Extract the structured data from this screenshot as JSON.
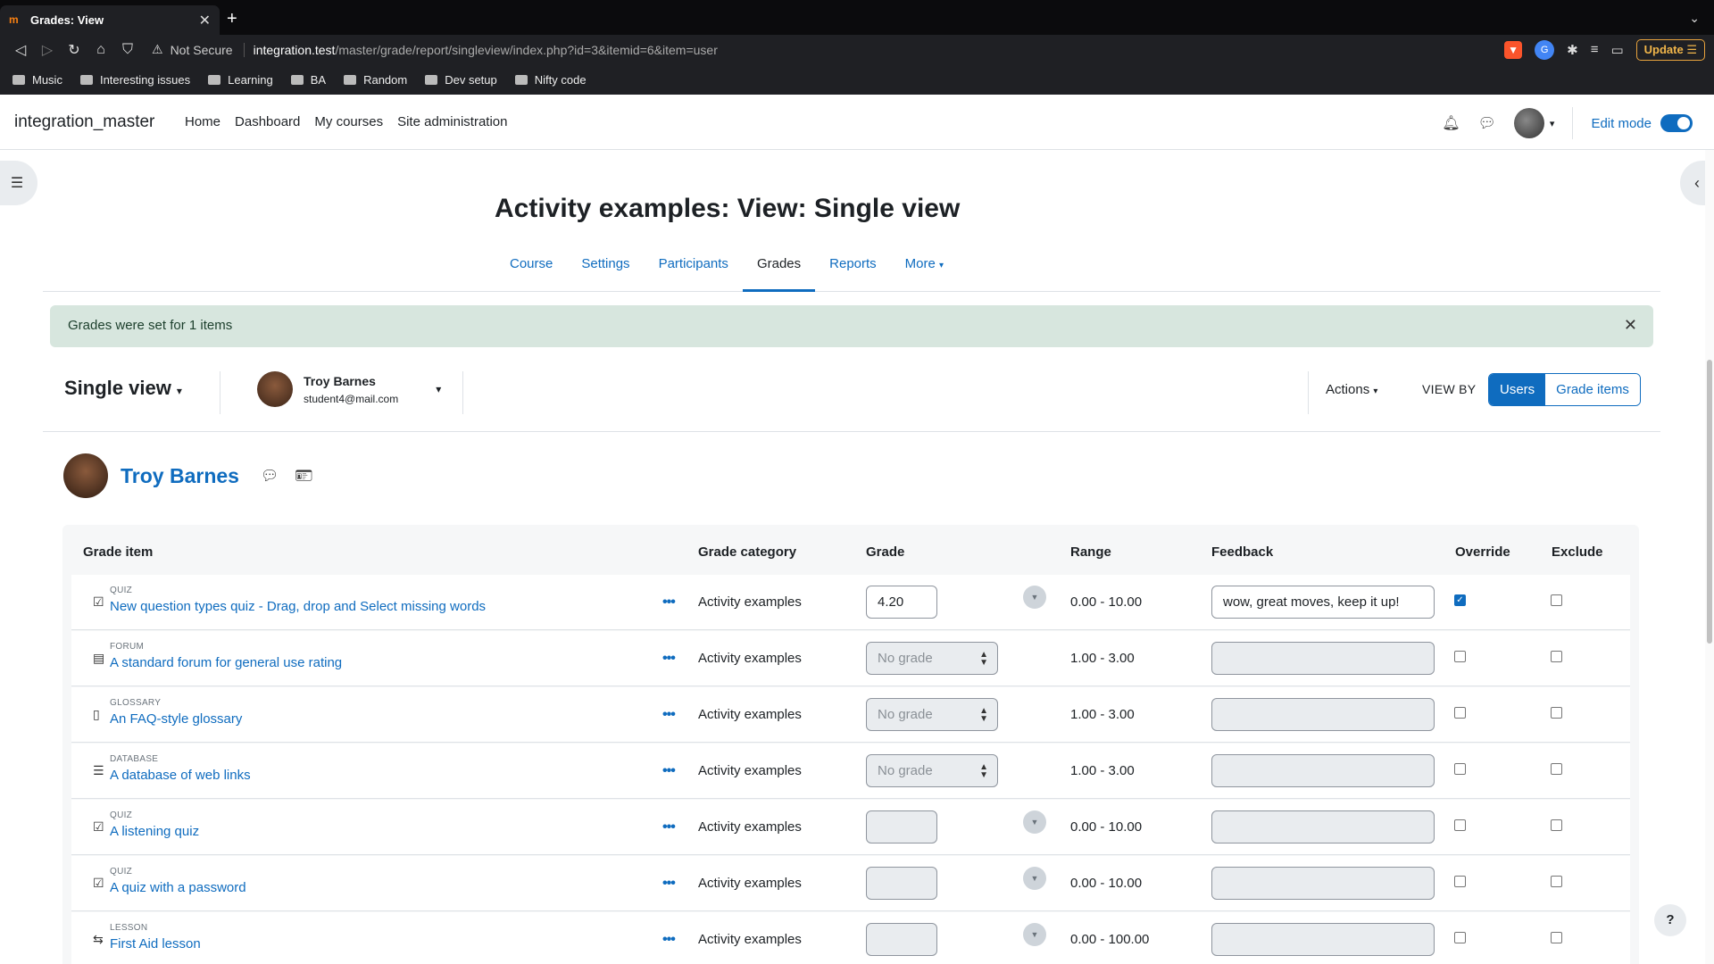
{
  "browser": {
    "tab_title": "Grades: View",
    "favicon": "m",
    "omnibox_warning": "Not Secure",
    "url_host": "integration.test",
    "url_path": "/master/grade/report/singleview/index.php?id=3&itemid=6&item=user",
    "update_label": "Update",
    "bookmarks": [
      "Music",
      "Interesting issues",
      "Learning",
      "BA",
      "Random",
      "Dev setup",
      "Nifty code"
    ]
  },
  "header": {
    "brand": "integration_master",
    "nav": [
      "Home",
      "Dashboard",
      "My courses",
      "Site administration"
    ],
    "edit_mode_label": "Edit mode"
  },
  "page": {
    "title": "Activity examples: View: Single view",
    "secondary_nav": [
      "Course",
      "Settings",
      "Participants",
      "Grades",
      "Reports",
      "More"
    ],
    "active_tab": "Grades",
    "alert": "Grades were set for 1 items"
  },
  "tertiary": {
    "view_title": "Single view",
    "user_name": "Troy Barnes",
    "user_email": "student4@mail.com",
    "actions_label": "Actions",
    "view_by_label": "VIEW BY",
    "view_users": "Users",
    "view_grade_items": "Grade items"
  },
  "user_heading": {
    "name": "Troy Barnes"
  },
  "table": {
    "headers": {
      "grade_item": "Grade item",
      "grade_category": "Grade category",
      "grade": "Grade",
      "range": "Range",
      "feedback": "Feedback",
      "override": "Override",
      "exclude": "Exclude"
    },
    "rows": [
      {
        "module": "QUIZ",
        "name": "New question types quiz - Drag, drop and Select missing words",
        "category": "Activity examples",
        "grade_type": "input",
        "grade": "4.20",
        "range": "0.00 - 10.00",
        "feedback": "wow, great moves, keep it up!",
        "override": true,
        "exclude": false
      },
      {
        "module": "FORUM",
        "name": "A standard forum for general use rating",
        "category": "Activity examples",
        "grade_type": "select",
        "grade": "No grade",
        "range": "1.00 - 3.00",
        "feedback": "",
        "override": false,
        "exclude": false
      },
      {
        "module": "GLOSSARY",
        "name": "An FAQ-style glossary",
        "category": "Activity examples",
        "grade_type": "select",
        "grade": "No grade",
        "range": "1.00 - 3.00",
        "feedback": "",
        "override": false,
        "exclude": false
      },
      {
        "module": "DATABASE",
        "name": "A database of web links",
        "category": "Activity examples",
        "grade_type": "select",
        "grade": "No grade",
        "range": "1.00 - 3.00",
        "feedback": "",
        "override": false,
        "exclude": false
      },
      {
        "module": "QUIZ",
        "name": "A listening quiz",
        "category": "Activity examples",
        "grade_type": "input",
        "grade": "",
        "range": "0.00 - 10.00",
        "feedback": "",
        "override": false,
        "exclude": false
      },
      {
        "module": "QUIZ",
        "name": "A quiz with a password",
        "category": "Activity examples",
        "grade_type": "input",
        "grade": "",
        "range": "0.00 - 10.00",
        "feedback": "",
        "override": false,
        "exclude": false
      },
      {
        "module": "LESSON",
        "name": "First Aid lesson",
        "category": "Activity examples",
        "grade_type": "input",
        "grade": "",
        "range": "0.00 - 100.00",
        "feedback": "",
        "override": false,
        "exclude": false
      }
    ]
  },
  "help_label": "?"
}
